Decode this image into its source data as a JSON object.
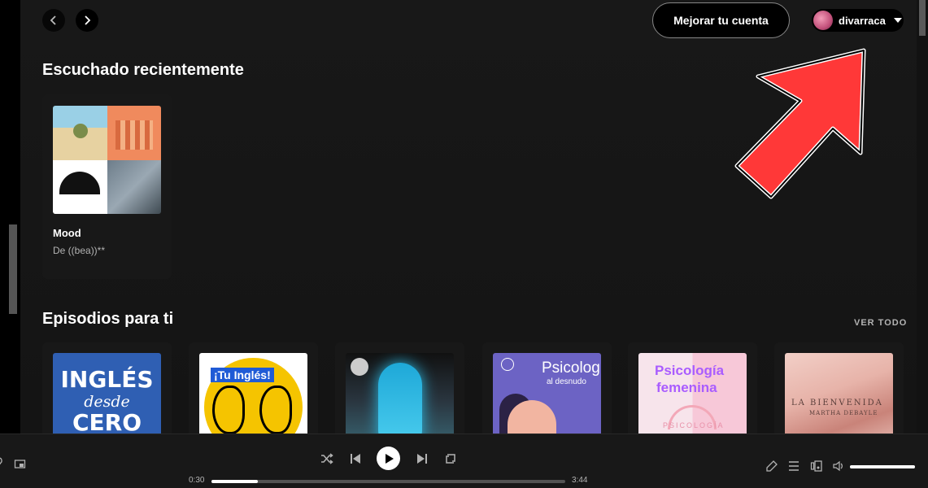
{
  "header": {
    "upgrade_label": "Mejorar tu cuenta",
    "user_name": "divarraca"
  },
  "recent": {
    "title": "Escuchado recientemente",
    "items": [
      {
        "title": "Mood",
        "subtitle": "De ((bea))**"
      }
    ]
  },
  "episodes": {
    "title": "Episodios para ti",
    "see_all": "VER TODO",
    "covers": [
      {
        "line1": "INGLÉS",
        "line2": "desde",
        "line3": "CERO"
      },
      {
        "line1": "¡Tu Inglés!"
      },
      {},
      {
        "line1": "Psicología",
        "line2": "al desnudo"
      },
      {
        "line1": "Psicología",
        "line2": "femenina",
        "line3": "PSICOLOGÍA"
      },
      {
        "line1": "LA BIENVENIDA",
        "line2": "MARTHA DEBAYLE"
      }
    ]
  },
  "player": {
    "elapsed": "0:30",
    "duration": "3:44",
    "progress_fraction": 0.13,
    "volume_fraction": 1.0
  },
  "colors": {
    "arrow": "#ff3838",
    "accent": "#ffffff"
  }
}
